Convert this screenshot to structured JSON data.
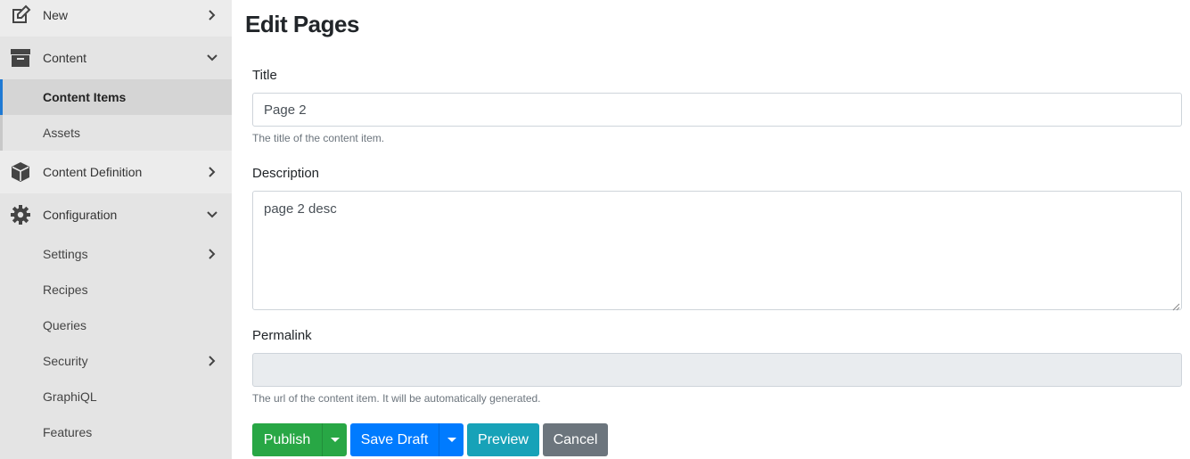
{
  "sidebar": {
    "new": {
      "label": "New",
      "icon": "edit-icon"
    },
    "content": {
      "label": "Content",
      "icon": "archive-box-icon",
      "items": [
        {
          "label": "Content Items",
          "active": true
        },
        {
          "label": "Assets"
        }
      ]
    },
    "content_definition": {
      "label": "Content Definition",
      "icon": "cube-icon"
    },
    "configuration": {
      "label": "Configuration",
      "icon": "gear-icon",
      "items": [
        {
          "label": "Settings",
          "has_children": true
        },
        {
          "label": "Recipes"
        },
        {
          "label": "Queries"
        },
        {
          "label": "Security",
          "has_children": true
        },
        {
          "label": "GraphiQL"
        },
        {
          "label": "Features"
        }
      ]
    }
  },
  "main": {
    "title": "Edit Pages",
    "title_field": {
      "label": "Title",
      "value": "Page 2",
      "help": "The title of the content item."
    },
    "description_field": {
      "label": "Description",
      "value": "page 2 desc"
    },
    "permalink_field": {
      "label": "Permalink",
      "value": "",
      "help": "The url of the content item. It will be automatically generated."
    },
    "buttons": {
      "publish": "Publish",
      "save_draft": "Save Draft",
      "preview": "Preview",
      "cancel": "Cancel"
    }
  },
  "colors": {
    "publish": "#28a745",
    "save_draft": "#007bff",
    "preview": "#17a2b8",
    "cancel": "#6c757d",
    "active_indicator": "#1f7ad4"
  }
}
